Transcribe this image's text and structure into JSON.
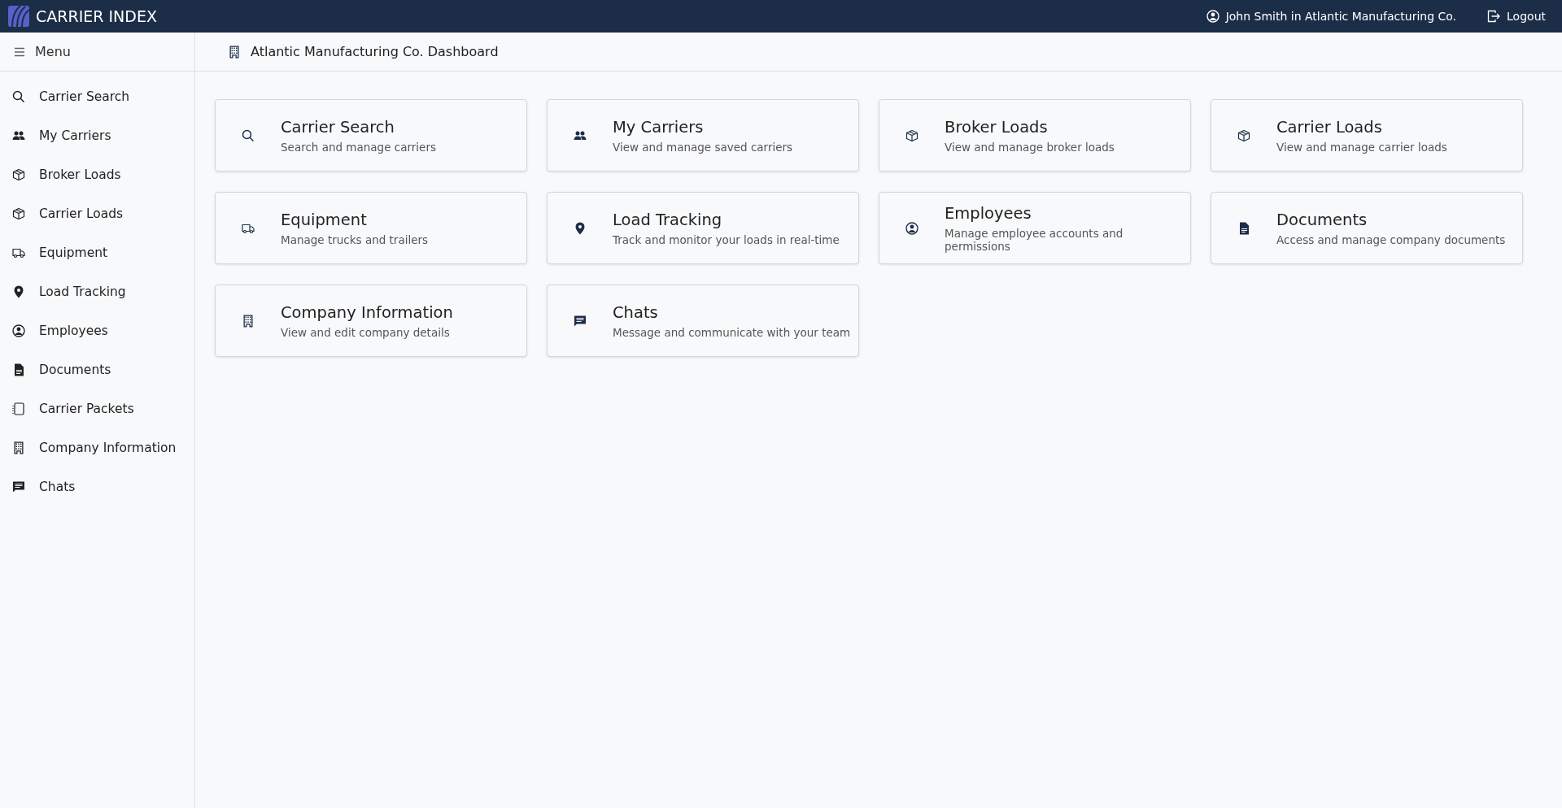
{
  "header": {
    "brand": "CARRIER INDEX",
    "user": "John Smith in Atlantic Manufacturing Co.",
    "logout": "Logout"
  },
  "sidebar": {
    "menu_label": "Menu",
    "items": [
      {
        "label": "Carrier Search"
      },
      {
        "label": "My Carriers"
      },
      {
        "label": "Broker Loads"
      },
      {
        "label": "Carrier Loads"
      },
      {
        "label": "Equipment"
      },
      {
        "label": "Load Tracking"
      },
      {
        "label": "Employees"
      },
      {
        "label": "Documents"
      },
      {
        "label": "Carrier Packets"
      },
      {
        "label": "Company Information"
      },
      {
        "label": "Chats"
      }
    ]
  },
  "page": {
    "title": "Atlantic Manufacturing Co. Dashboard"
  },
  "cards": [
    {
      "title": "Carrier Search",
      "description": "Search and manage carriers"
    },
    {
      "title": "My Carriers",
      "description": "View and manage saved carriers"
    },
    {
      "title": "Broker Loads",
      "description": "View and manage broker loads"
    },
    {
      "title": "Carrier Loads",
      "description": "View and manage carrier loads"
    },
    {
      "title": "Equipment",
      "description": "Manage trucks and trailers"
    },
    {
      "title": "Load Tracking",
      "description": "Track and monitor your loads in real-time"
    },
    {
      "title": "Employees",
      "description": "Manage employee accounts and permissions"
    },
    {
      "title": "Documents",
      "description": "Access and manage company documents"
    },
    {
      "title": "Company Information",
      "description": "View and edit company details"
    },
    {
      "title": "Chats",
      "description": "Message and communicate with your team"
    }
  ]
}
